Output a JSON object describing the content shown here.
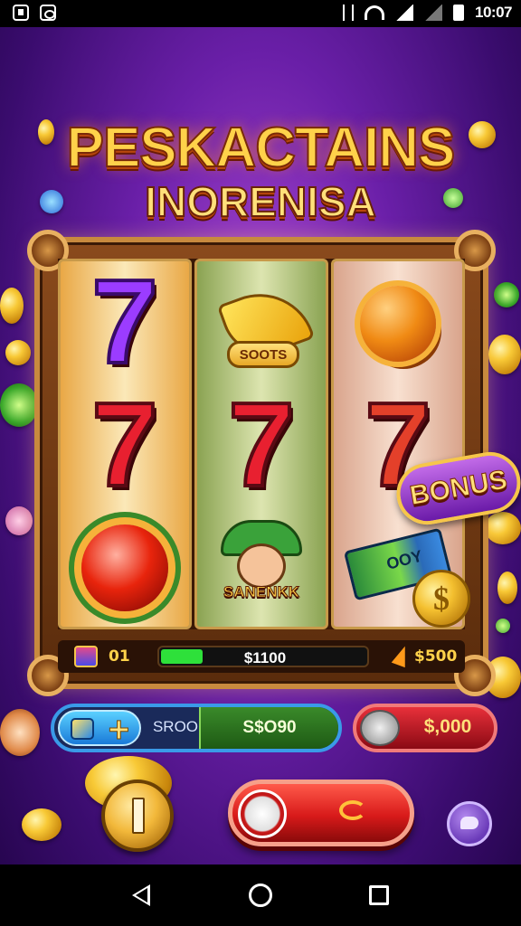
{
  "status_bar": {
    "time": "10:07"
  },
  "title": {
    "line1": "PESKACTAINS",
    "line2": "INORENISA"
  },
  "reels": [
    [
      "7",
      "7",
      "jewel"
    ],
    [
      "banana",
      "7",
      "girl"
    ],
    [
      "orb",
      "7",
      "cash"
    ]
  ],
  "symbols": {
    "banana_tag": "SOOTS",
    "girl_name": "SANENKK",
    "cash_text": "OOY"
  },
  "bonus_badge": "BONUS",
  "info_bar": {
    "lines": "01",
    "win": "$1100",
    "coins": "$500"
  },
  "controls": {
    "bet_label": "SROO",
    "bet_value": "S$O90",
    "balance": "$,000"
  },
  "colors": {
    "accent_gold": "#ffd24a",
    "spin_red": "#d81a1a",
    "background_purple": "#6a1fa8"
  },
  "icons": {
    "add": "plus-icon",
    "max_bet": "coin-icon",
    "spin": "spin-icon",
    "settings": "chat-icon",
    "balance": "wallet-icon"
  }
}
